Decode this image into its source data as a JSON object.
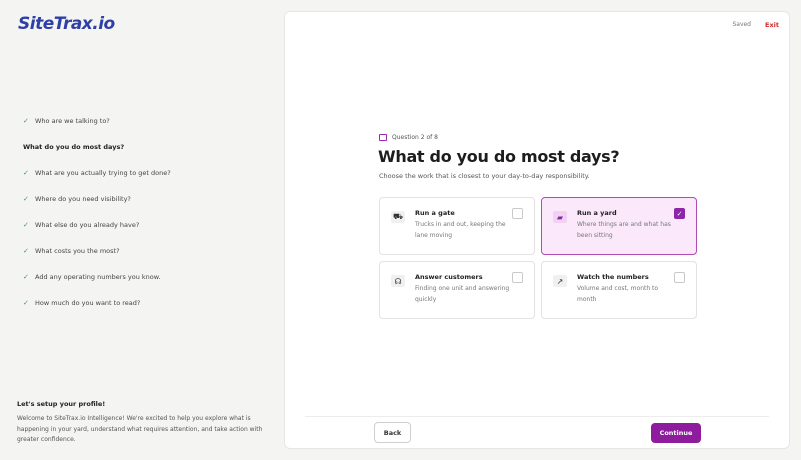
{
  "brand": {
    "logo_text": "SiteTrax.io",
    "accent": "#8e1d9e",
    "logo_color": "#2f3fa8"
  },
  "sidebar": {
    "steps": [
      {
        "label": "Who are we talking to?",
        "done": true
      },
      {
        "label": "What do you do most days?",
        "done": false,
        "current": true
      },
      {
        "label": "What are you actually trying to get done?",
        "done": true
      },
      {
        "label": "Where do you need visibility?",
        "done": true
      },
      {
        "label": "What else do you already have?",
        "done": true
      },
      {
        "label": "What costs you the most?",
        "done": true
      },
      {
        "label": "Add any operating numbers you know.",
        "done": true
      },
      {
        "label": "How much do you want to read?",
        "done": true
      }
    ],
    "check_glyph": "✓",
    "profile_title": "Let's setup your profile!",
    "profile_text": "Welcome to SiteTrax.io Intelligence! We're excited to help you explore what is happening in your yard, understand what requires attention, and take action with greater confidence."
  },
  "header": {
    "saved_label": "Saved",
    "exit_label": "Exit"
  },
  "question": {
    "counter": "Question 2 of 8",
    "title": "What do you do most days?",
    "subtitle": "Choose the work that is closest to your day-to-day responsibility."
  },
  "options": [
    {
      "title": "Run a gate",
      "desc": "Trucks in and out, keeping the lane moving",
      "icon": "truck-icon",
      "icon_glyph": "⛟",
      "selected": false
    },
    {
      "title": "Run a yard",
      "desc": "Where things are and what has been sitting",
      "icon": "yard-icon",
      "icon_glyph": "▰",
      "selected": true
    },
    {
      "title": "Answer customers",
      "desc": "Finding one unit and answering quickly",
      "icon": "headset-icon",
      "icon_glyph": "☊",
      "selected": false
    },
    {
      "title": "Watch the numbers",
      "desc": "Volume and cost, month to month",
      "icon": "chart-icon",
      "icon_glyph": "↗",
      "selected": false
    }
  ],
  "footer": {
    "back_label": "Back",
    "continue_label": "Continue"
  }
}
